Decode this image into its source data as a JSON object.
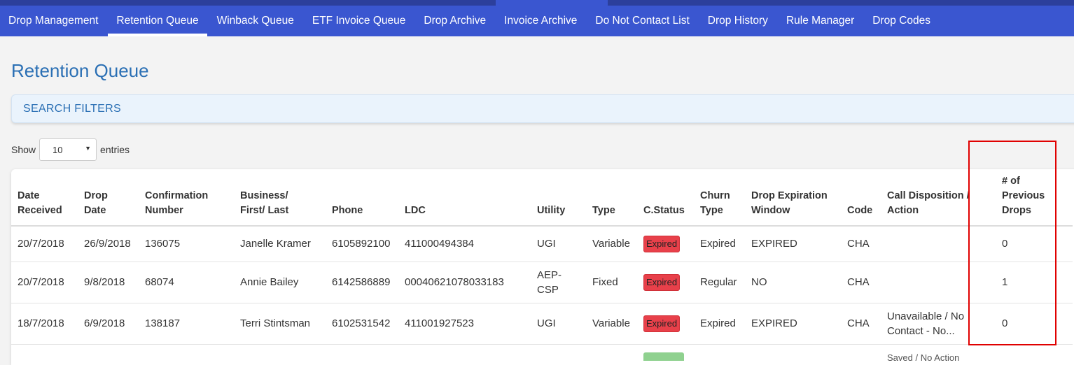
{
  "nav": {
    "items": [
      {
        "label": "Drop Management"
      },
      {
        "label": "Retention Queue"
      },
      {
        "label": "Winback Queue"
      },
      {
        "label": "ETF Invoice Queue"
      },
      {
        "label": "Drop Archive"
      },
      {
        "label": "Invoice Archive"
      },
      {
        "label": "Do Not Contact List"
      },
      {
        "label": "Drop History"
      },
      {
        "label": "Rule Manager"
      },
      {
        "label": "Drop Codes"
      }
    ],
    "active": "Retention Queue"
  },
  "page": {
    "title": "Retention Queue"
  },
  "filters": {
    "label": "SEARCH FILTERS"
  },
  "length": {
    "show": "Show",
    "value": "10",
    "entries": "entries"
  },
  "table": {
    "headers": [
      [
        "Date",
        "Received"
      ],
      [
        "Drop",
        "Date"
      ],
      [
        "Confirmation",
        "Number"
      ],
      [
        "Business/",
        "First/ Last"
      ],
      [
        "Phone"
      ],
      [
        "LDC"
      ],
      [
        "Utility"
      ],
      [
        "Type"
      ],
      [
        "C.Status"
      ],
      [
        "Churn",
        "Type"
      ],
      [
        "Drop Expiration",
        "Window"
      ],
      [
        "Code"
      ],
      [
        "Call Disposition /",
        "Action"
      ],
      [
        "# of",
        "Previous",
        "Drops"
      ]
    ],
    "rows": [
      {
        "date_received": "20/7/2018",
        "drop_date": "26/9/2018",
        "confirmation": "136075",
        "name": "Janelle Kramer",
        "phone": "6105892100",
        "ldc": "411000494384",
        "utility": [
          "UGI"
        ],
        "type": "Variable",
        "status": "Expired",
        "churn": "Expired",
        "window": "EXPIRED",
        "code": "CHA",
        "disposition": [
          "",
          ""
        ],
        "prev_drops": "0"
      },
      {
        "date_received": "20/7/2018",
        "drop_date": "9/8/2018",
        "confirmation": "68074",
        "name": "Annie Bailey",
        "phone": "6142586889",
        "ldc": "00040621078033183",
        "utility": [
          "AEP-",
          "CSP"
        ],
        "type": "Fixed",
        "status": "Expired",
        "churn": "Regular",
        "window": "NO",
        "code": "CHA",
        "disposition": [
          "",
          ""
        ],
        "prev_drops": "1"
      },
      {
        "date_received": "18/7/2018",
        "drop_date": "6/9/2018",
        "confirmation": "138187",
        "name": "Terri Stintsman",
        "phone": "6102531542",
        "ldc": "411001927523",
        "utility": [
          "UGI"
        ],
        "type": "Variable",
        "status": "Expired",
        "churn": "Expired",
        "window": "EXPIRED",
        "code": "CHA",
        "disposition": [
          "Unavailable / No",
          "Contact - No..."
        ],
        "prev_drops": "0"
      }
    ],
    "partial_row": {
      "disposition": "Saved / No Action"
    }
  },
  "colors": {
    "nav_bg": "#3a56d0",
    "title": "#2a6fb4",
    "badge_expired": "#e8404a",
    "highlight_box": "#e00000"
  }
}
